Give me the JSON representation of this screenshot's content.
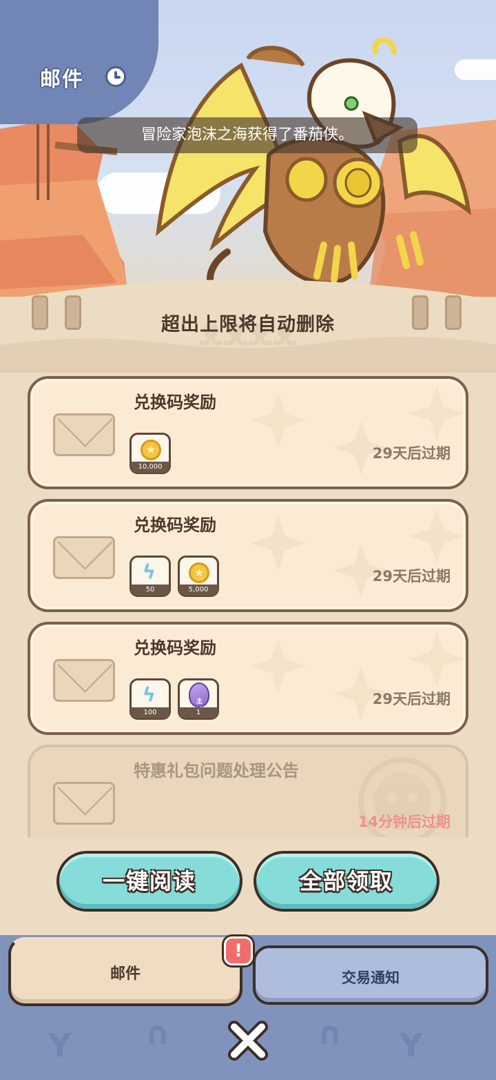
{
  "header": {
    "title": "邮件"
  },
  "banner": {
    "text": "冒险家泡沫之海获得了番茄侠。"
  },
  "panel": {
    "hint": "超出上限将自动删除"
  },
  "mails": [
    {
      "title": "兑换码奖励",
      "expire": "29天后过期",
      "rewards": [
        {
          "icon": "coin-icon",
          "qty": "10,000"
        }
      ]
    },
    {
      "title": "兑换码奖励",
      "expire": "29天后过期",
      "rewards": [
        {
          "icon": "energy-bolt-icon",
          "qty": "50"
        },
        {
          "icon": "coin-icon",
          "qty": "5,000"
        }
      ]
    },
    {
      "title": "兑换码奖励",
      "expire": "29天后过期",
      "rewards": [
        {
          "icon": "energy-bolt-icon",
          "qty": "100"
        },
        {
          "icon": "egg-icon",
          "label": "主线",
          "qty": "1"
        }
      ]
    },
    {
      "title": "特惠礼包问题处理公告",
      "expire": "14分钟后过期",
      "rewards": []
    }
  ],
  "actions": {
    "read_all": "一键阅读",
    "claim_all": "全部领取"
  },
  "tabs": {
    "mail": "邮件",
    "trade": "交易通知",
    "alert_badge": "!"
  },
  "colors": {
    "accent_button": "#86dcd9",
    "panel": "#ecdcc4",
    "bottom_bar": "#7f93bd",
    "urgent_expire": "#f0918a"
  }
}
